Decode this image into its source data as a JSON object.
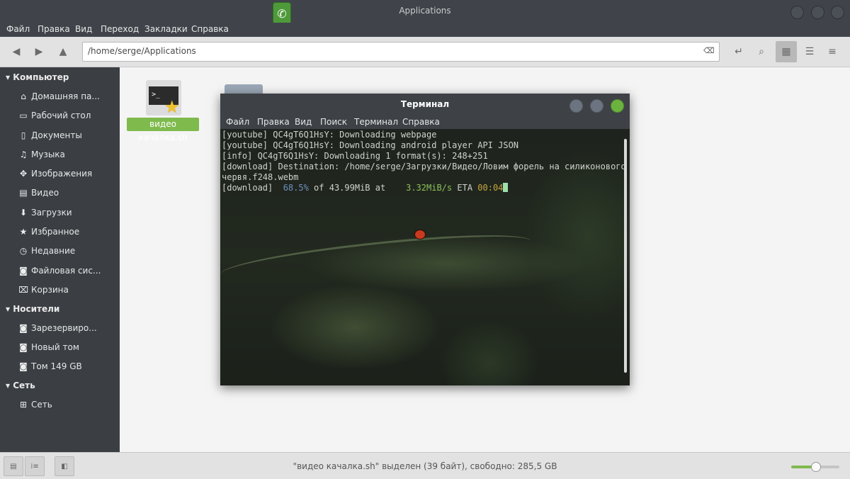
{
  "window": {
    "title": "Applications"
  },
  "menubar": [
    "Файл",
    "Правка",
    "Вид",
    "Переход",
    "Закладки",
    "Справка"
  ],
  "toolbar": {
    "path": "/home/serge/Applications"
  },
  "sidebar": {
    "computer_header": "Компьютер",
    "computer_items": [
      {
        "label": "Домашняя па...",
        "icon": "home-icon"
      },
      {
        "label": "Рабочий стол",
        "icon": "desktop-icon"
      },
      {
        "label": "Документы",
        "icon": "document-icon"
      },
      {
        "label": "Музыка",
        "icon": "music-icon"
      },
      {
        "label": "Изображения",
        "icon": "image-icon"
      },
      {
        "label": "Видео",
        "icon": "video-icon"
      },
      {
        "label": "Загрузки",
        "icon": "download-icon"
      },
      {
        "label": "Избранное",
        "icon": "star-icon"
      },
      {
        "label": "Недавние",
        "icon": "clock-icon"
      },
      {
        "label": "Файловая сис...",
        "icon": "drive-icon"
      },
      {
        "label": "Корзина",
        "icon": "trash-icon"
      }
    ],
    "devices_header": "Носители",
    "devices_items": [
      {
        "label": "Зарезервиро...",
        "icon": "drive-icon"
      },
      {
        "label": "Новый том",
        "icon": "drive-icon"
      },
      {
        "label": "Том 149 GB",
        "icon": "drive-icon"
      }
    ],
    "network_header": "Сеть",
    "network_items": [
      {
        "label": "Сеть",
        "icon": "network-icon"
      }
    ]
  },
  "files": [
    {
      "name": "видео качалка.sh",
      "selected": true,
      "icon": "terminal-script-icon"
    }
  ],
  "terminal": {
    "title": "Терминал",
    "menu": [
      "Файл",
      "Правка",
      "Вид",
      "Поиск",
      "Терминал",
      "Справка"
    ],
    "lines": [
      "[youtube] QC4gT6Q1HsY: Downloading webpage",
      "[youtube] QC4gT6Q1HsY: Downloading android player API JSON",
      "[info] QC4gT6Q1HsY: Downloading 1 format(s): 248+251",
      "[download] Destination: /home/serge/Загрузки/Видео/Ловим форель на силиконового",
      "червя.f248.webm"
    ],
    "progress": {
      "prefix": "[download]  ",
      "percent": "68.5%",
      "of_text": " of 43.99MiB at    ",
      "speed": "3.32MiB/s",
      "eta_label": " ETA ",
      "eta": "00:04"
    }
  },
  "status": {
    "text": "\"видео качалка.sh\" выделен (39 байт), свободно: 285,5 GB",
    "zoom_level": 0.5
  },
  "colors": {
    "accent": "#7fba4d",
    "sidebar_bg": "#3b3f44"
  }
}
